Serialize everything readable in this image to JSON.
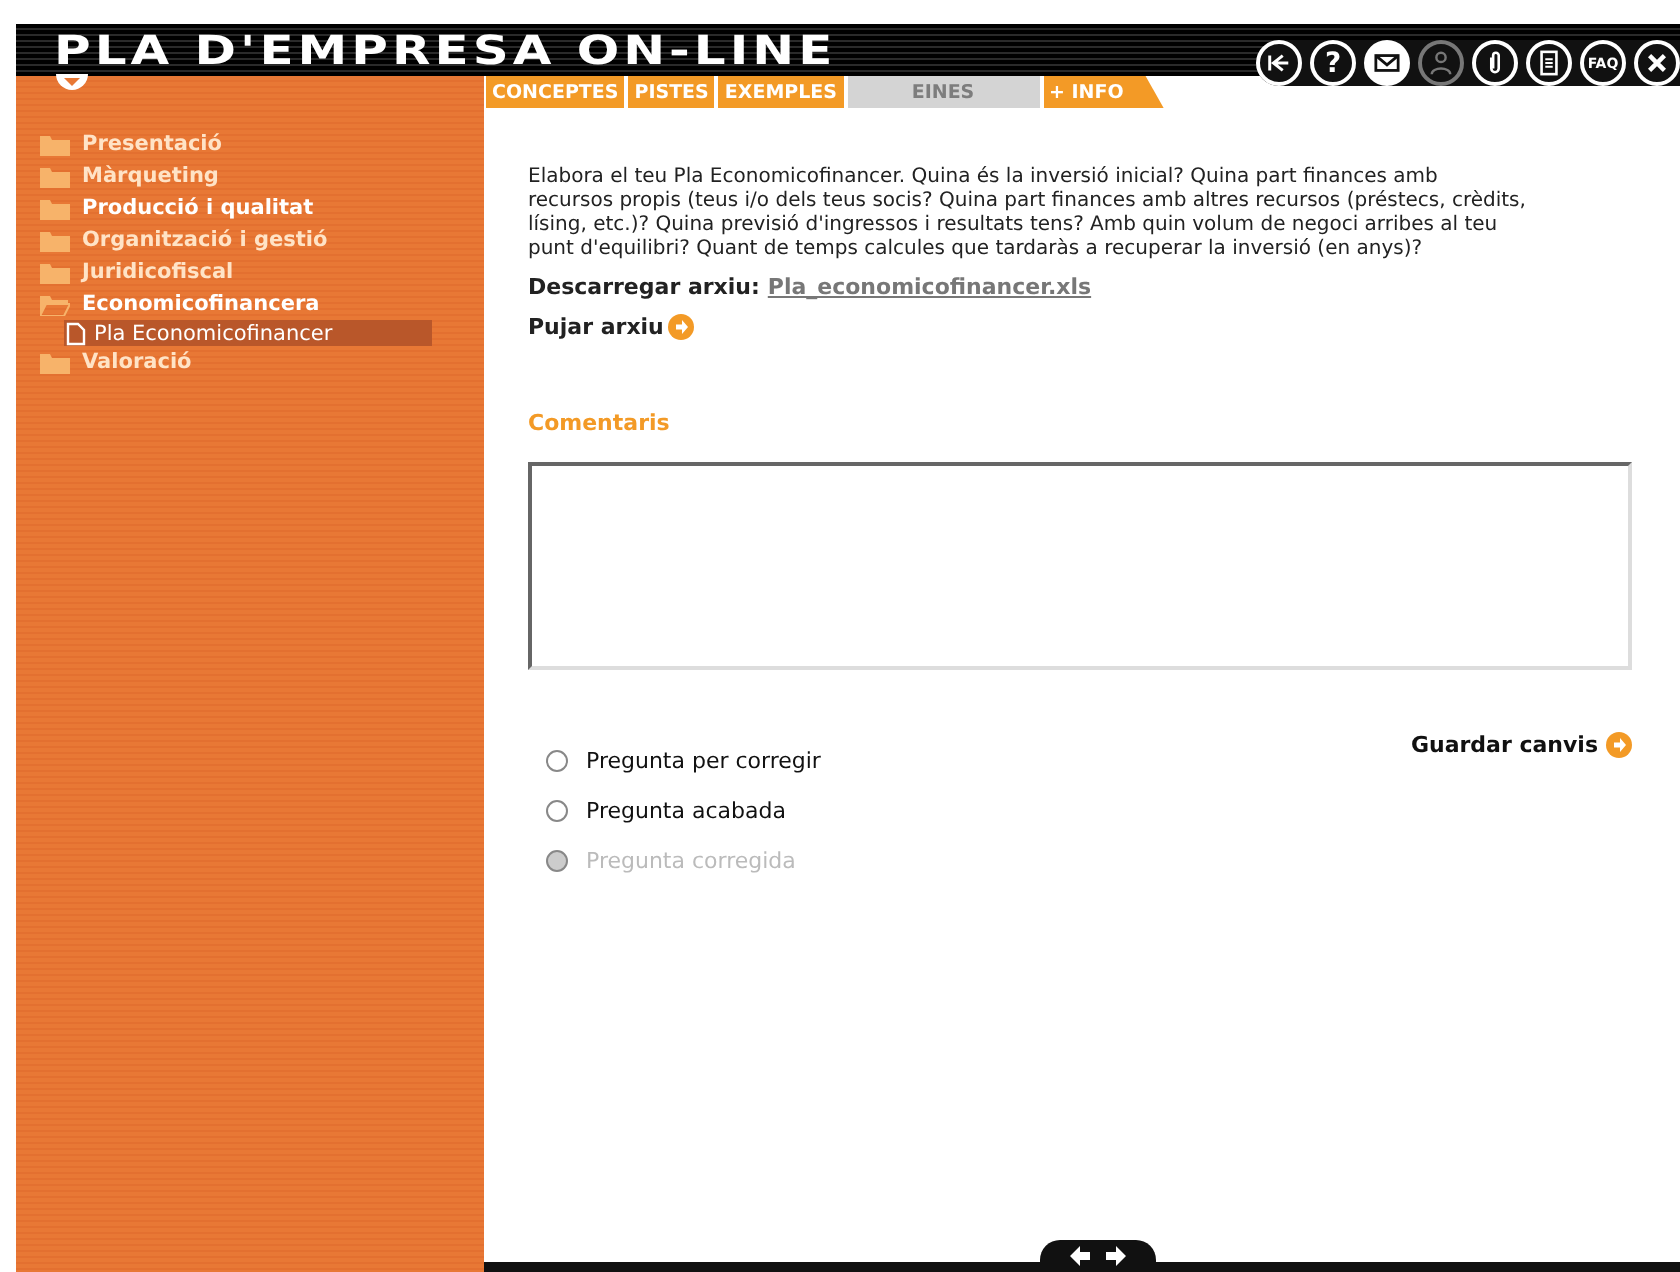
{
  "window": {
    "title": "PLA D'EMPRESA ON-LINE"
  },
  "toolbar": [
    {
      "kind": "back",
      "selected": false,
      "disabled": false
    },
    {
      "kind": "text",
      "label": "?",
      "selected": false,
      "disabled": false
    },
    {
      "kind": "mail",
      "selected": true,
      "disabled": false
    },
    {
      "kind": "person",
      "selected": false,
      "disabled": true
    },
    {
      "kind": "clip",
      "selected": false,
      "disabled": false
    },
    {
      "kind": "doc",
      "selected": false,
      "disabled": false
    },
    {
      "kind": "faq",
      "label": "FAQ",
      "selected": false,
      "disabled": false
    },
    {
      "kind": "close",
      "selected": false,
      "disabled": false
    }
  ],
  "tabs": [
    {
      "label": "CONCEPTES",
      "disabled": false
    },
    {
      "label": "PISTES",
      "disabled": false
    },
    {
      "label": "EXEMPLES",
      "disabled": false
    },
    {
      "label": "EINES",
      "disabled": true
    },
    {
      "label": "+ INFO",
      "disabled": false
    }
  ],
  "sidebar": {
    "items": [
      {
        "label": "Presentació",
        "active": false,
        "expanded": false
      },
      {
        "label": "Màrqueting",
        "active": false,
        "expanded": false
      },
      {
        "label": "Producció i qualitat",
        "active": true,
        "expanded": false
      },
      {
        "label": "Organització i gestió",
        "active": false,
        "expanded": false
      },
      {
        "label": "Juridicofiscal",
        "active": false,
        "expanded": false
      },
      {
        "label": "Economicofinancera",
        "active": true,
        "expanded": true,
        "children": [
          {
            "label": "Pla Economicofinancer",
            "selected": true
          }
        ]
      },
      {
        "label": "Valoració",
        "active": false,
        "expanded": false
      }
    ]
  },
  "content": {
    "question": "Elabora el teu Pla Economicofinancer. Quina és la inversió inicial? Quina part finances amb recursos propis (teus i/o dels teus socis? Quina part finances amb altres recursos (préstecs, crèdits, lísing, etc.)? Quina previsió d'ingressos i resultats tens? Amb quin volum de negoci arribes al teu punt d'equilibri? Quant de temps calcules que tardaràs a recuperar la inversió (en anys)?",
    "download_label": "Descarregar arxiu:",
    "download_link": "Pla_economicofinancer.xls",
    "upload_label": "Pujar arxiu",
    "comments_heading": "Comentaris",
    "status_options": [
      {
        "label": "Pregunta per corregir",
        "selected": false,
        "disabled": false
      },
      {
        "label": "Pregunta acabada",
        "selected": false,
        "disabled": false
      },
      {
        "label": "Pregunta corregida",
        "selected": false,
        "disabled": true
      }
    ],
    "save_label": "Guardar canvis"
  }
}
